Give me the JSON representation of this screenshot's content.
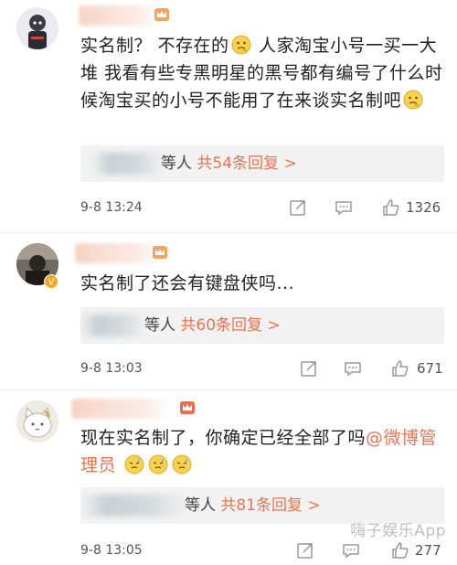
{
  "comments": [
    {
      "text_parts": [
        "实名制？ 不存在的",
        " 人家淘宝小号一买一大堆 我看有些专黑明星的黑号都有编号了什么时候淘宝买的小号不能用了在来谈实名制吧"
      ],
      "reply_suffix": "等人",
      "reply_link": "共54条回复 >",
      "time": "9-8 13:24",
      "likes": "1326"
    },
    {
      "text_parts": [
        "实名制了还会有键盘侠吗..."
      ],
      "reply_suffix": "等人",
      "reply_link": "共60条回复 >",
      "time": "9-8 13:03",
      "likes": "671"
    },
    {
      "text_parts": [
        "现在实名制了，你确定已经全部了吗"
      ],
      "mention": "@微博管理员",
      "reply_suffix": "等人",
      "reply_link": "共81条回复 >",
      "time": "9-8 13:05",
      "likes": "277"
    }
  ],
  "watermark": "嗨子娱乐App",
  "icons": {
    "share": "share-icon",
    "comment": "comment-icon",
    "like": "like-icon",
    "crown": "crown-badge-icon",
    "verified": "verified-badge-icon",
    "emoji_think": "thinking-emoji-icon",
    "emoji_sweat": "sweat-emoji-icon"
  },
  "colors": {
    "accent": "#eb7350",
    "reply_bg": "#f2f2f2",
    "icon_gray": "#9a9a9a"
  }
}
